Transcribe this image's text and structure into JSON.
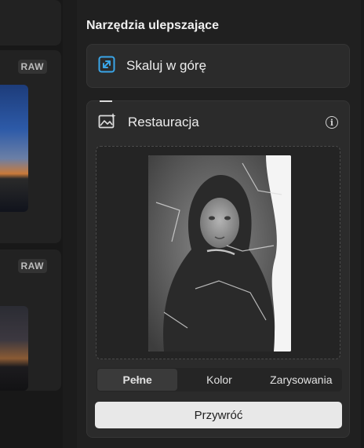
{
  "thumbnails": [
    {
      "badge": "RAW"
    },
    {
      "badge": "RAW"
    }
  ],
  "panel": {
    "title": "Narzędzia ulepszające",
    "upscale": {
      "label": "Skaluj w górę",
      "icon": "upscale-icon"
    },
    "restoration": {
      "label": "Restauracja",
      "icon": "image-sparkle-icon",
      "info_icon": "info-icon",
      "modes": [
        {
          "label": "Pełne",
          "active": true
        },
        {
          "label": "Kolor",
          "active": false
        },
        {
          "label": "Zarysowania",
          "active": false
        }
      ],
      "restore_label": "Przywróć"
    }
  },
  "colors": {
    "accent": "#3aa6e8",
    "panel_bg": "#202020",
    "card_bg": "#2b2b2b",
    "restore_bg": "#e8e8e8"
  }
}
